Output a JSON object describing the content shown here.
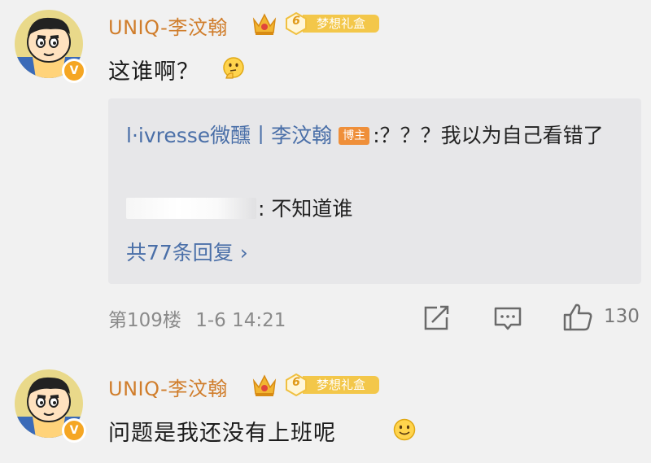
{
  "comments": [
    {
      "username": "UNIQ-李汶翰",
      "vip_label": "梦想礼盒",
      "vip_level": "6",
      "verified_mark": "V",
      "text": "这谁啊？",
      "emoji": "thinking-face-icon",
      "replies": {
        "reply1_author": "l·ivresse微醺丨李汶翰",
        "reply1_tag": "博主",
        "reply1_text": ":？？？我以为自己看错了",
        "reply2_text": ": 不知道谁",
        "more_replies": "共77条回复 ›"
      },
      "floor": "第109楼",
      "time": "1-6 14:21",
      "likes": "130"
    },
    {
      "username": "UNIQ-李汶翰",
      "vip_label": "梦想礼盒",
      "vip_level": "6",
      "verified_mark": "V",
      "text": "问题是我还没有上班呢",
      "emoji": "smile-face-icon"
    }
  ],
  "colors": {
    "background": "#f1f1f1",
    "username": "#d07d2b",
    "link": "#4a6fa8",
    "reply_box": "#e7e7e9",
    "meta": "#8a8a8a",
    "blogger_tag": "#ef8f3a"
  }
}
